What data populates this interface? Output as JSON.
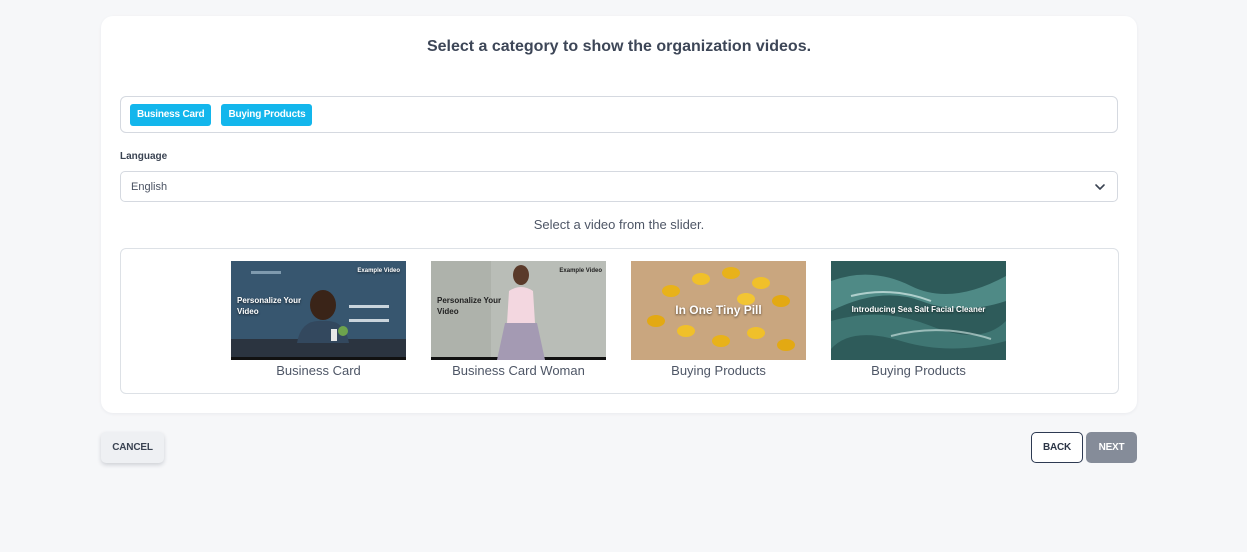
{
  "card": {
    "title": "Select a category to show the organization videos."
  },
  "tags": [
    "Business Card",
    "Buying Products"
  ],
  "language": {
    "label": "Language",
    "selected": "English"
  },
  "slider": {
    "hint": "Select a video from the slider.",
    "videos": [
      {
        "caption": "Business Card",
        "overlay_title": "Personalize Your Video",
        "overlay_badge": "Example Video"
      },
      {
        "caption": "Business Card Woman",
        "overlay_title": "Personalize Your Video",
        "overlay_badge": "Example Video"
      },
      {
        "caption": "Buying Products",
        "overlay_title": "In One Tiny Pill"
      },
      {
        "caption": "Buying Products",
        "overlay_title": "Introducing Sea Salt Facial Cleaner"
      }
    ]
  },
  "buttons": {
    "cancel": "CANCEL",
    "back": "BACK",
    "next": "NEXT"
  },
  "colors": {
    "tag": "#13b6ec",
    "next_disabled": "#858c99",
    "background": "#f6f7f9"
  }
}
